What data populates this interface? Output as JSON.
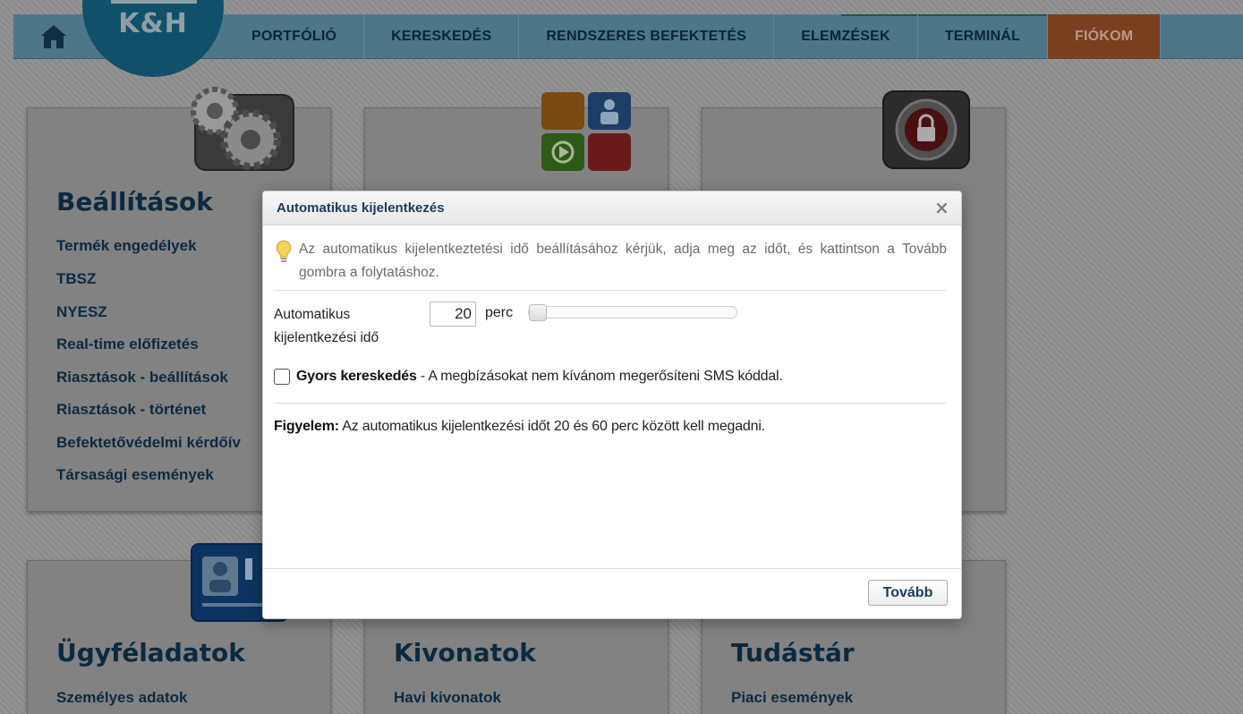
{
  "nav": {
    "logo_text": "K&H",
    "items": [
      {
        "label": "PORTFÓLIÓ"
      },
      {
        "label": "KERESKEDÉS"
      },
      {
        "label": "RENDSZERES BEFEKTETÉS"
      },
      {
        "label": "ELEMZÉSEK"
      },
      {
        "label": "TERMINÁL"
      },
      {
        "label": "FIÓKOM",
        "active": true
      }
    ]
  },
  "cards": {
    "settings": {
      "title": "Beállítások",
      "links": [
        "Termék engedélyek",
        "TBSZ",
        "NYESZ",
        "Real-time előfizetés",
        "Riasztások - beállítások",
        "Riasztások - történet",
        "Befektetővédelmi kérdőív",
        "Társasági események"
      ]
    },
    "client": {
      "title": "Ügyféladatok",
      "links": [
        "Személyes adatok"
      ]
    },
    "statements": {
      "title": "Kivonatok",
      "links": [
        "Havi kivonatok"
      ]
    },
    "knowledge": {
      "title": "Tudástár",
      "links": [
        "Piaci események"
      ]
    }
  },
  "dialog": {
    "title": "Automatikus kijelentkezés",
    "close_symbol": "×",
    "info": "Az automatikus kijelentkeztetési idő beállításához kérjük, adja meg az időt, és kattintson a Tovább gombra a folytatáshoz.",
    "timeout_label": "Automatikus kijelentkezési idő",
    "timeout_value": "20",
    "timeout_unit": "perc",
    "slider": {
      "min": 20,
      "max": 60,
      "value": 20
    },
    "fast_trading_bold": "Gyors kereskedés",
    "fast_trading_text": " - A megbízásokat nem kívánom megerősíteni SMS kóddal.",
    "fast_trading_checked": false,
    "warning_bold": "Figyelem:",
    "warning_text": " Az automatikus kijelentkezési időt 20 és 60 perc között kell megadni.",
    "next_label": "Tovább"
  }
}
